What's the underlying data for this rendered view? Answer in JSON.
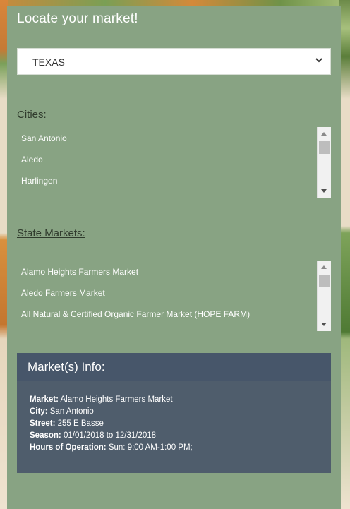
{
  "title": "Locate your market!",
  "state_select": {
    "value": "TEXAS"
  },
  "cities": {
    "label": "Cities:",
    "items": [
      "San Antonio",
      "Aledo",
      "Harlingen"
    ]
  },
  "state_markets": {
    "label": "State Markets:",
    "items": [
      "Alamo Heights Farmers Market",
      "Aledo Farmers Market",
      "All Natural & Certified Organic Farmer Market (HOPE FARM)"
    ]
  },
  "market_info": {
    "title": "Market(s) Info:",
    "market_label": "Market:",
    "market": "Alamo Heights Farmers Market",
    "city_label": "City:",
    "city": "San Antonio",
    "street_label": "Street:",
    "street": "255 E Basse",
    "season_label": "Season:",
    "season": "01/01/2018 to 12/31/2018",
    "hours_label": "Hours of Operation:",
    "hours": "Sun: 9:00 AM-1:00 PM;"
  },
  "colors": {
    "panel": "#88a383",
    "info_card": "#4f5d6c",
    "info_header": "#47566a"
  },
  "icons": [
    "chevron-down-icon",
    "scroll-up-arrow-icon",
    "scroll-down-arrow-icon"
  ]
}
